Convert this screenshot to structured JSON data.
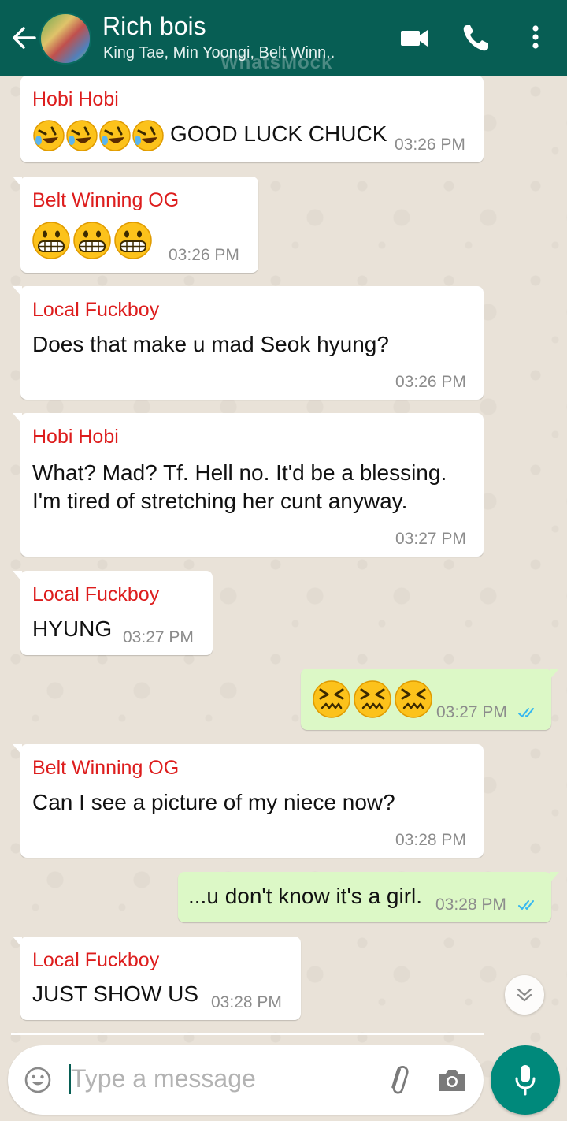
{
  "header": {
    "title": "Rich bois",
    "subtitle": "King Tae, Min Yoongi, Belt Winn..",
    "watermark": "WhatsMock",
    "back_icon": "arrow-left-icon",
    "video_icon": "video-call-icon",
    "call_icon": "phone-icon",
    "menu_icon": "more-vert-icon"
  },
  "colors": {
    "header": "#075e54",
    "sender": "#dd1d1d",
    "outgoing_bubble": "#dcf8c6",
    "incoming_bubble": "#ffffff",
    "read_ticks": "#34b7f1",
    "mic_button": "#00897b"
  },
  "messages": [
    {
      "sender": "Hobi Hobi",
      "text": "GOOD LUCK CHUCK",
      "emoji": "rolling-on-floor-laughing x4",
      "time": "03:26 PM"
    },
    {
      "sender": "Belt Winning OG",
      "text": "",
      "emoji": "grimacing-face x3",
      "time": "03:26 PM"
    },
    {
      "sender": "Local Fuckboy",
      "text": "Does that make u mad Seok hyung?",
      "time": "03:26 PM"
    },
    {
      "sender": "Hobi Hobi",
      "text_line1": "What? Mad? Tf. Hell no. It'd be a blessing.",
      "text_line2": "I'm tired of stretching her cunt anyway.",
      "time": "03:27 PM"
    },
    {
      "sender": "Local Fuckboy",
      "text": "HYUNG",
      "time": "03:27 PM"
    },
    {
      "sender": "",
      "text": "",
      "emoji": "confounded-face x3",
      "time": "03:27 PM",
      "status": "read"
    },
    {
      "sender": "Belt Winning OG",
      "text": "Can I see a picture of my niece now?",
      "time": "03:28 PM"
    },
    {
      "sender": "",
      "text": "...u don't know it's a girl.",
      "time": "03:28 PM",
      "status": "read"
    },
    {
      "sender": "Local Fuckboy",
      "text": "JUST SHOW US",
      "time": "03:28 PM"
    }
  ],
  "composer": {
    "placeholder": "Type a message",
    "emoji_icon": "smiley-icon",
    "attach_icon": "paperclip-icon",
    "camera_icon": "camera-icon",
    "mic_icon": "microphone-icon",
    "scroll_icon": "double-chevron-down-icon"
  }
}
